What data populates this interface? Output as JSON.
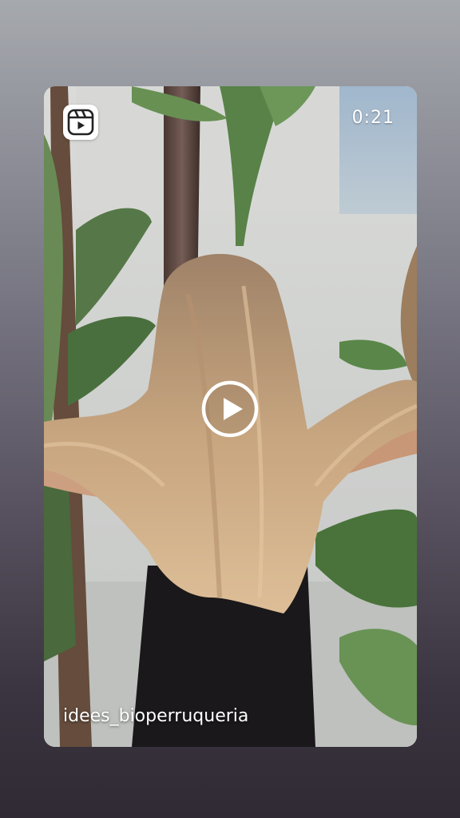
{
  "reel": {
    "duration": "0:21",
    "username": "idees_bioperruqueria",
    "badge_icon": "reels-icon",
    "play_icon": "play-icon"
  }
}
